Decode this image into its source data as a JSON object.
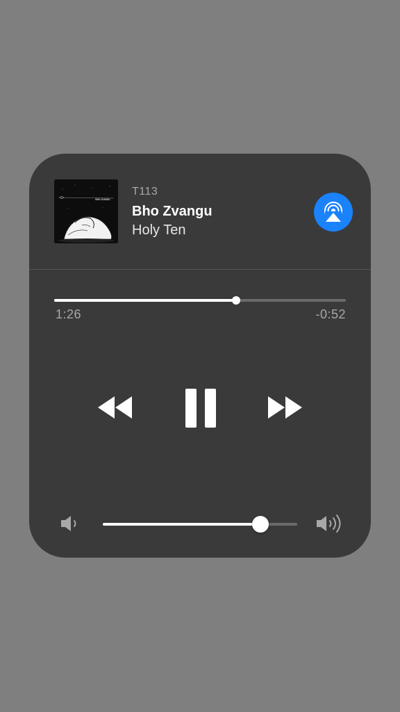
{
  "now_playing": {
    "source": "T113",
    "title": "Bho Zvangu",
    "artist": "Holy Ten",
    "album_art_text": "BHO ZVANGU"
  },
  "airplay": {
    "icon": "airplay-icon",
    "color": "#1a82fb"
  },
  "playback": {
    "elapsed": "1:26",
    "remaining": "-0:52",
    "progress_fraction": 0.623,
    "state": "playing"
  },
  "volume": {
    "level_fraction": 0.81
  },
  "icons": {
    "rewind": "rewind-icon",
    "pause": "pause-icon",
    "fast_forward": "fast-forward-icon",
    "volume_low": "volume-low-icon",
    "volume_high": "volume-high-icon"
  }
}
